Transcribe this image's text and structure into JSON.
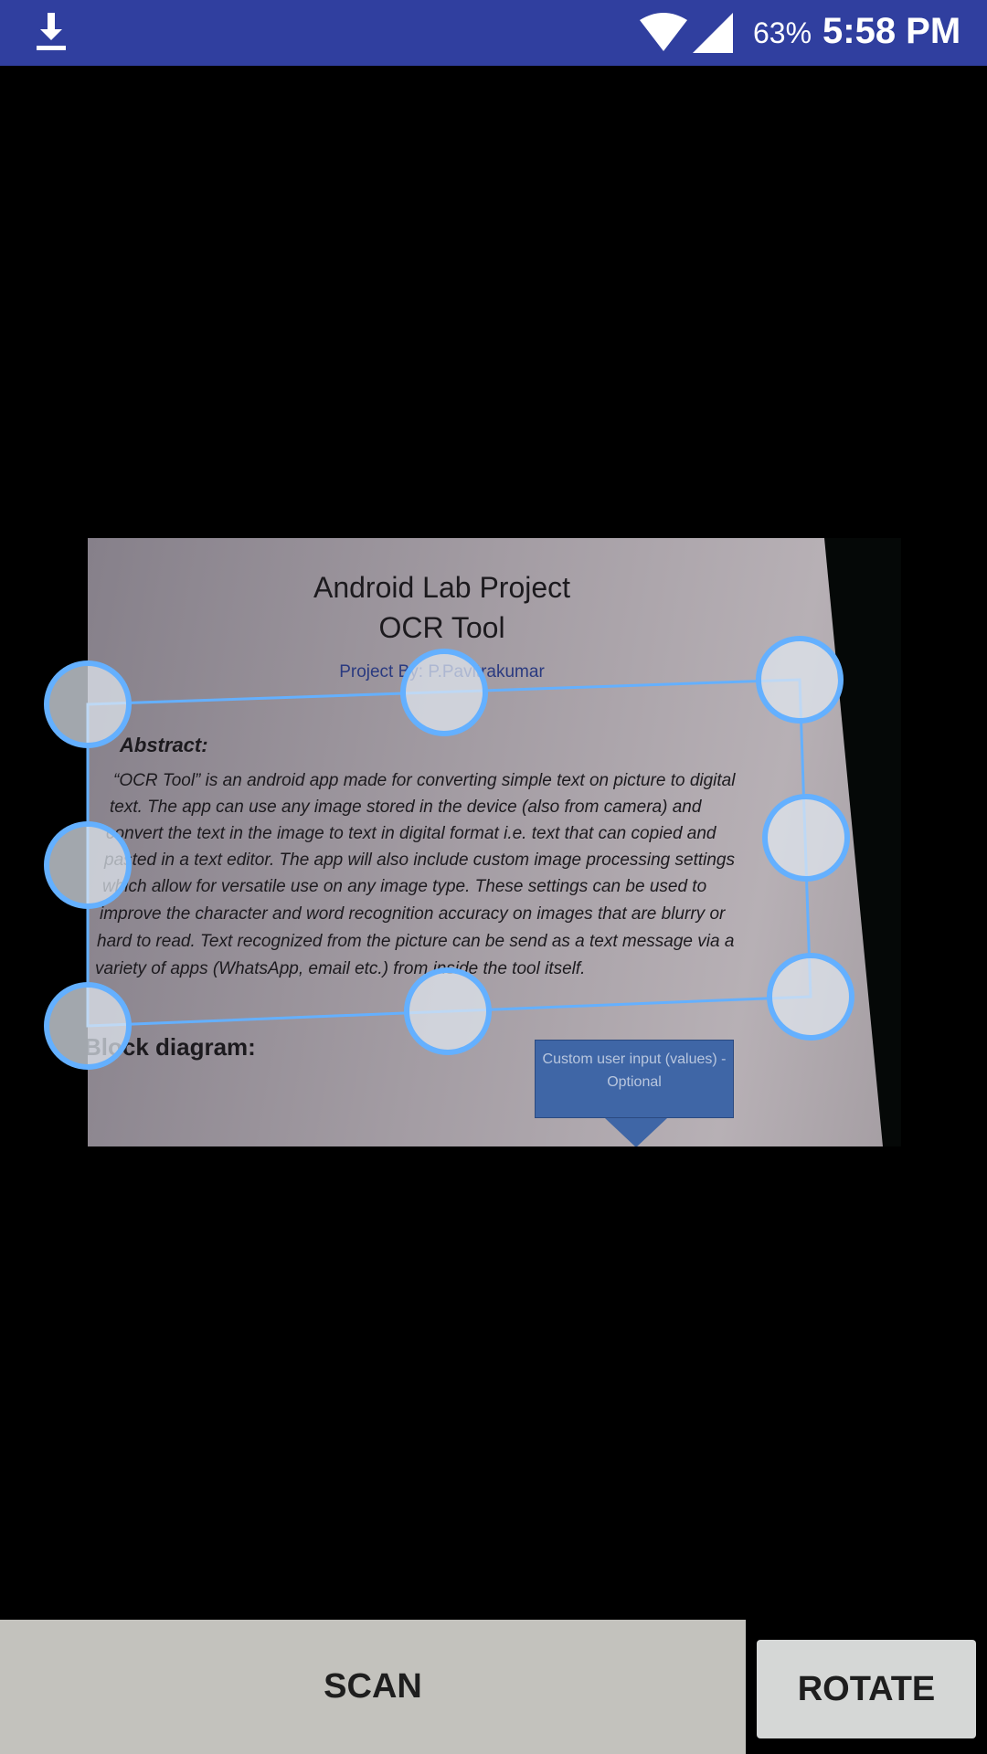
{
  "status_bar": {
    "battery": "63%",
    "time": "5:58 PM",
    "icons": [
      "download-icon",
      "wifi-icon",
      "cell-signal-icon"
    ],
    "color": "#303f9f"
  },
  "document": {
    "title_line1": "Android Lab Project",
    "title_line2": "OCR Tool",
    "author": "Project By: P.Pavitrakumar",
    "abstract_heading": "Abstract:",
    "abstract_lines": [
      "“OCR Tool” is an android app made for converting simple text on picture to digital",
      "text. The app can use any image stored in the device (also from camera) and",
      "convert the text in the image to text in digital format i.e. text that can copied and",
      "pasted in a text editor. The app will also include custom image processing settings",
      "which allow for versatile use on any image type. These settings can be used to",
      "improve the character and word recognition accuracy on images that are blurry or",
      "hard to read. Text recognized from the picture can be send as a text message via a",
      "variety of apps (WhatsApp, email etc.) from inside the tool itself."
    ],
    "block_heading": "Block diagram:",
    "diagram_box": "Custom user input (values) - Optional"
  },
  "crop": {
    "handle_color": "#64b0ff"
  },
  "buttons": {
    "scan": "SCAN",
    "rotate": "ROTATE"
  }
}
